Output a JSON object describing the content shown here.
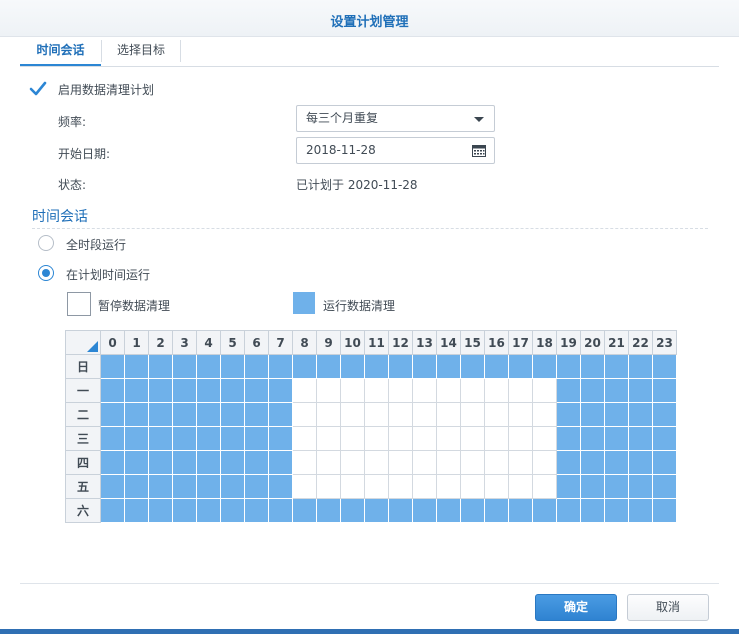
{
  "window": {
    "title": "设置计划管理"
  },
  "tabs": [
    {
      "label": "时间会话",
      "active": true
    },
    {
      "label": "选择目标",
      "active": false
    }
  ],
  "enable": {
    "label": "启用数据清理计划",
    "checked": true
  },
  "frequency": {
    "label": "频率:",
    "value": "每三个月重复"
  },
  "start_date": {
    "label": "开始日期:",
    "value": "2018-11-28"
  },
  "status": {
    "label": "状态:",
    "value": "已计划于 2020-11-28"
  },
  "session": {
    "title": "时间会话",
    "option_all": {
      "label": "全时段运行",
      "selected": false
    },
    "option_scheduled": {
      "label": "在计划时间运行",
      "selected": true
    }
  },
  "legend": {
    "paused": "暂停数据清理",
    "running": "运行数据清理"
  },
  "schedule": {
    "hours": [
      "0",
      "1",
      "2",
      "3",
      "4",
      "5",
      "6",
      "7",
      "8",
      "9",
      "10",
      "11",
      "12",
      "13",
      "14",
      "15",
      "16",
      "17",
      "18",
      "19",
      "20",
      "21",
      "22",
      "23"
    ],
    "days": [
      {
        "label": "日",
        "hours": [
          1,
          1,
          1,
          1,
          1,
          1,
          1,
          1,
          1,
          1,
          1,
          1,
          1,
          1,
          1,
          1,
          1,
          1,
          1,
          1,
          1,
          1,
          1,
          1
        ]
      },
      {
        "label": "一",
        "hours": [
          1,
          1,
          1,
          1,
          1,
          1,
          1,
          1,
          0,
          0,
          0,
          0,
          0,
          0,
          0,
          0,
          0,
          0,
          0,
          1,
          1,
          1,
          1,
          1
        ]
      },
      {
        "label": "二",
        "hours": [
          1,
          1,
          1,
          1,
          1,
          1,
          1,
          1,
          0,
          0,
          0,
          0,
          0,
          0,
          0,
          0,
          0,
          0,
          0,
          1,
          1,
          1,
          1,
          1
        ]
      },
      {
        "label": "三",
        "hours": [
          1,
          1,
          1,
          1,
          1,
          1,
          1,
          1,
          0,
          0,
          0,
          0,
          0,
          0,
          0,
          0,
          0,
          0,
          0,
          1,
          1,
          1,
          1,
          1
        ]
      },
      {
        "label": "四",
        "hours": [
          1,
          1,
          1,
          1,
          1,
          1,
          1,
          1,
          0,
          0,
          0,
          0,
          0,
          0,
          0,
          0,
          0,
          0,
          0,
          1,
          1,
          1,
          1,
          1
        ]
      },
      {
        "label": "五",
        "hours": [
          1,
          1,
          1,
          1,
          1,
          1,
          1,
          1,
          0,
          0,
          0,
          0,
          0,
          0,
          0,
          0,
          0,
          0,
          0,
          1,
          1,
          1,
          1,
          1
        ]
      },
      {
        "label": "六",
        "hours": [
          1,
          1,
          1,
          1,
          1,
          1,
          1,
          1,
          1,
          1,
          1,
          1,
          1,
          1,
          1,
          1,
          1,
          1,
          1,
          1,
          1,
          1,
          1,
          1
        ]
      }
    ]
  },
  "buttons": {
    "ok": "确定",
    "cancel": "取消"
  },
  "colors": {
    "accent": "#2c86d4",
    "running": "#6fb1ea",
    "title": "#1f6fb8"
  },
  "icons": {
    "enable_checkbox": "checkmark-icon",
    "date_picker": "calendar-icon",
    "dropdown": "chevron-down-icon"
  }
}
